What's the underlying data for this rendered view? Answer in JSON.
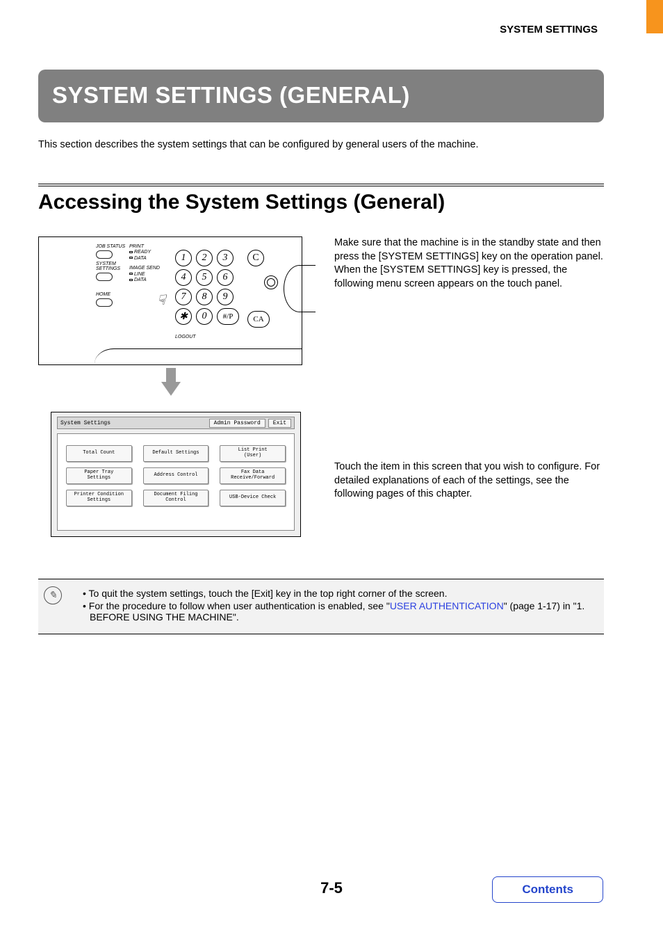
{
  "header": {
    "section": "SYSTEM SETTINGS"
  },
  "title": "SYSTEM SETTINGS (GENERAL)",
  "intro": "This section describes the system settings that can be configured by general users of the machine.",
  "h2": "Accessing the System Settings (General)",
  "panel": {
    "job_status": "JOB STATUS",
    "system_settings": "SYSTEM\nSETTINGS",
    "home": "HOME",
    "print": "PRINT",
    "ready": "READY",
    "data1": "DATA",
    "image_send": "IMAGE SEND",
    "line": "LINE",
    "data2": "DATA",
    "logout": "LOGOUT",
    "keys": [
      "1",
      "2",
      "3",
      "4",
      "5",
      "6",
      "7",
      "8",
      "9",
      "✱",
      "0",
      "#/P"
    ],
    "c_key": "C",
    "ca_key": "CA"
  },
  "para1": "Make sure that the machine is in the standby state and then press the [SYSTEM SETTINGS] key on the operation panel.\nWhen the [SYSTEM SETTINGS] key is pressed, the following menu screen appears on the touch panel.",
  "touch": {
    "title": "System Settings",
    "admin": "Admin Password",
    "exit": "Exit",
    "buttons": [
      "Total Count",
      "Default Settings",
      "List Print\n(User)",
      "Paper Tray\nSettings",
      "Address Control",
      "Fax Data\nReceive/Forward",
      "Printer Condition\nSettings",
      "Document Filing\nControl",
      "USB-Device Check"
    ]
  },
  "para2": "Touch the item in this screen that you wish to configure. For detailed explanations of each of the settings, see the following pages of this chapter.",
  "notes": {
    "n1": "To quit the system settings, touch the [Exit] key in the top right corner of the screen.",
    "n2a": "For the procedure to follow when user authentication is enabled, see \"",
    "n2link": "USER AUTHENTICATION",
    "n2b": "\" (page 1-17) in \"1. BEFORE USING THE MACHINE\"."
  },
  "page_number": "7-5",
  "contents_label": "Contents"
}
